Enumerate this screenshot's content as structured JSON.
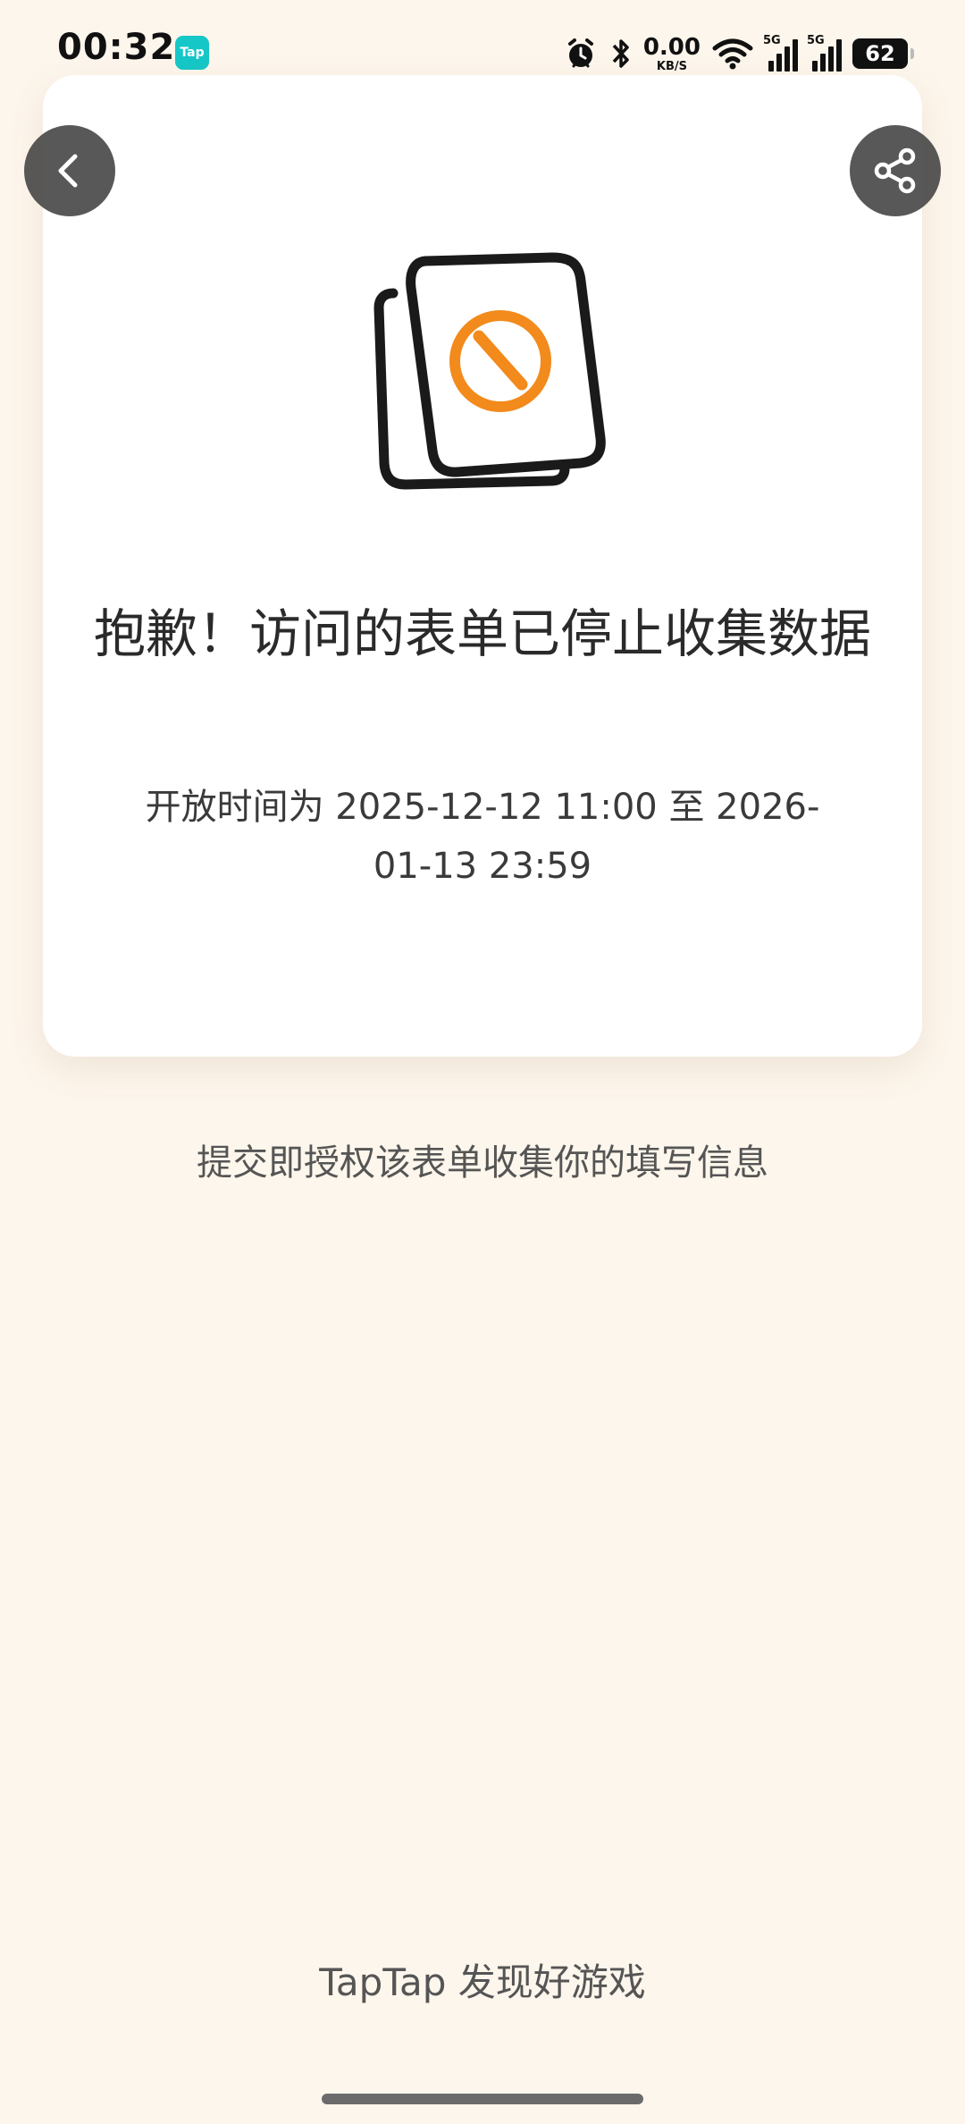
{
  "status_bar": {
    "time": "00:32",
    "app_badge": "Tap",
    "net_speed": "0.00",
    "net_unit": "KB/S",
    "signal1_label": "5G",
    "signal2_label": "5G",
    "battery": "62",
    "icons": [
      "alarm-icon",
      "bluetooth-icon",
      "wifi-icon",
      "signal-icon",
      "signal-icon",
      "battery-icon"
    ]
  },
  "card": {
    "title": "抱歉！访问的表单已停止收集数据",
    "subtitle": "开放时间为 2025-12-12 11:00 至 2026-01-13 23:59"
  },
  "notice": "提交即授权该表单收集你的填写信息",
  "footer": "TapTap 发现好游戏",
  "colors": {
    "background": "#fdf6ec",
    "card": "#ffffff",
    "accent": "#f28a1c",
    "app_badge": "#16c7c7"
  }
}
